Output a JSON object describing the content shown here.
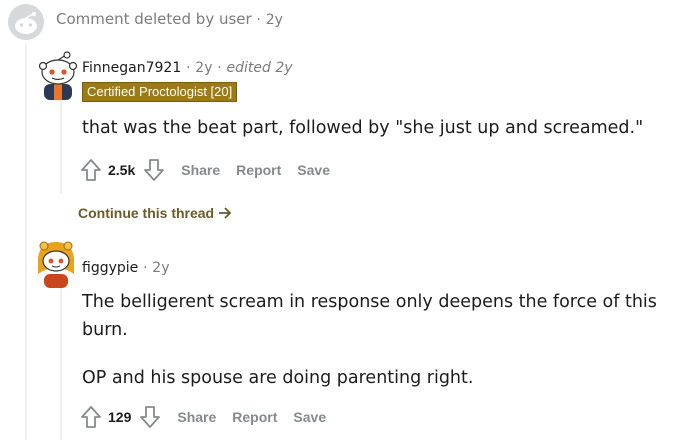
{
  "deleted_comment": {
    "text": "Comment deleted by user",
    "separator": "·",
    "age": "2y"
  },
  "comment1": {
    "username": "Finnegan7921",
    "separator": "·",
    "age": "2y",
    "separator2": "·",
    "edited": "edited 2y",
    "flair": "Certified Proctologist [20]",
    "body": "that was the beat part, followed by \"she just up and screamed.\"",
    "score": "2.5k",
    "actions": {
      "share": "Share",
      "report": "Report",
      "save": "Save"
    },
    "continue_thread": "Continue this thread"
  },
  "comment2": {
    "username": "figgypie",
    "separator": "·",
    "age": "2y",
    "body_paragraph_1_line_1": "The belligerent scream in response only deepens the force of this",
    "body_paragraph_1_line_2": "burn.",
    "body_paragraph_2": "OP and his spouse are doing parenting right.",
    "score": "129",
    "actions": {
      "share": "Share",
      "report": "Report",
      "save": "Save"
    }
  },
  "colors": {
    "flair_bg": "#9c7a16",
    "continue_link": "#6a5a2c",
    "muted": "#878a8c"
  }
}
